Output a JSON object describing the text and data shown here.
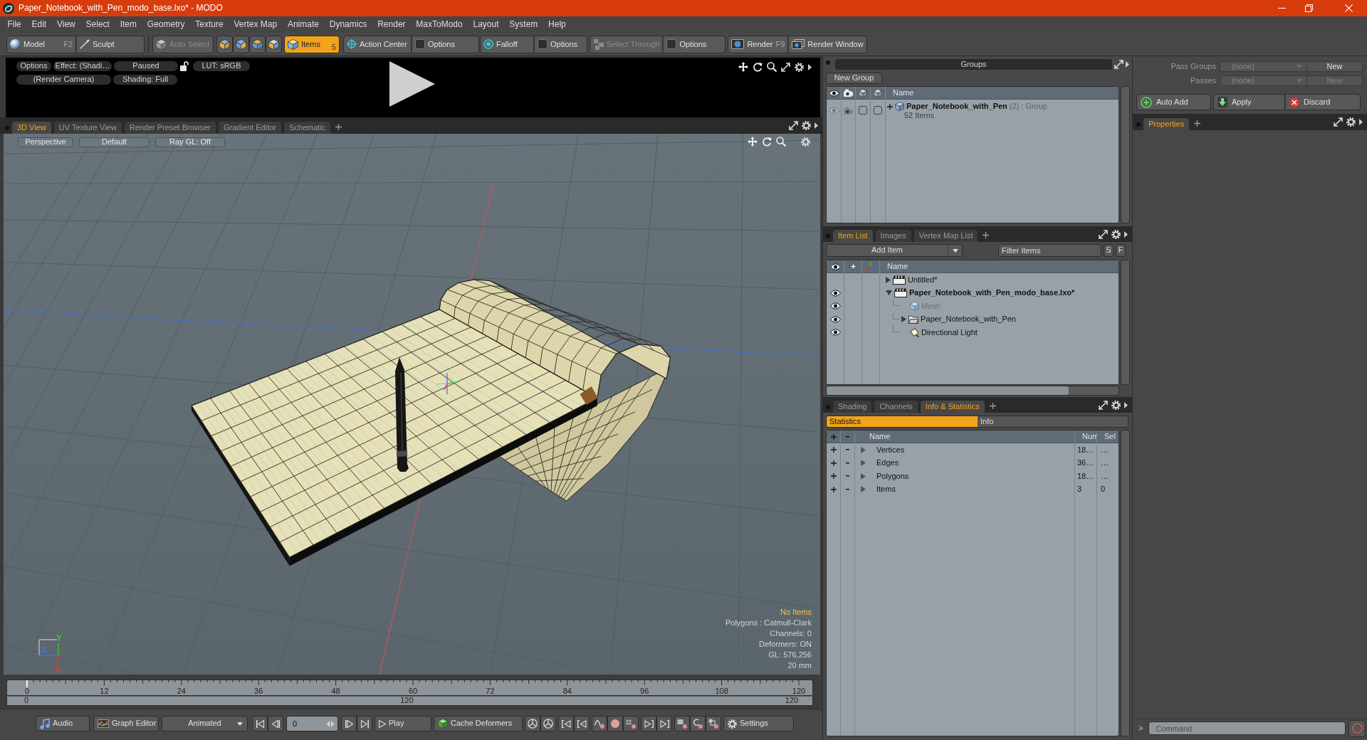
{
  "window": {
    "title": "Paper_Notebook_with_Pen_modo_base.lxo* - MODO"
  },
  "menu": [
    "File",
    "Edit",
    "View",
    "Select",
    "Item",
    "Geometry",
    "Texture",
    "Vertex Map",
    "Animate",
    "Dynamics",
    "Render",
    "MaxToModo",
    "Layout",
    "System",
    "Help"
  ],
  "toolbar": {
    "model": {
      "label": "Model",
      "shortcut": "F2"
    },
    "sculpt": {
      "label": "Sculpt"
    },
    "auto_select": {
      "label": "Auto Select",
      "disabled": true
    },
    "selection_modes": [
      {
        "kind": "icon",
        "selected": false
      },
      {
        "kind": "icon",
        "selected": false
      },
      {
        "kind": "icon",
        "selected": false
      },
      {
        "kind": "icon",
        "selected": false
      },
      {
        "kind": "labeled",
        "label": "Items",
        "shortcut": "5",
        "selected": true
      }
    ],
    "action_center": {
      "label": "Action Center",
      "options": {
        "label": "Options",
        "checked": false
      }
    },
    "falloff": {
      "label": "Falloff",
      "options": {
        "label": "Options",
        "checked": false
      }
    },
    "select_through": {
      "label": "Select Through",
      "disabled": true,
      "options": {
        "label": "Options",
        "checked": false
      }
    },
    "render": {
      "label": "Render",
      "shortcut": "F9"
    },
    "render_window": {
      "label": "Render Window"
    }
  },
  "preview": {
    "options": "Options",
    "effect": "Effect: (Shadi…",
    "state": "Paused",
    "lut": "LUT: sRGB",
    "camera": "(Render Camera)",
    "shading": "Shading: Full"
  },
  "viewport_tabs": [
    {
      "label": "3D View",
      "selected": true
    },
    {
      "label": "UV Texture View",
      "selected": false
    },
    {
      "label": "Render Preset Browser",
      "selected": false
    },
    {
      "label": "Gradient Editor",
      "selected": false
    },
    {
      "label": "Schematic",
      "selected": false
    }
  ],
  "viewport": {
    "view_buttons": [
      "Perspective",
      "Default",
      "Ray GL: Off"
    ],
    "selection_info": "No Items",
    "info_lines": [
      "Polygons : Catmull-Clark",
      "Channels: 0",
      "Deformers: ON",
      "GL: 576,256",
      "20 mm"
    ],
    "axis_labels": [
      {
        "label": "Y",
        "color": "#3ec43e"
      },
      {
        "label": "Z",
        "color": "#4a6cf0"
      },
      {
        "label": "X",
        "color": "#e03c3c"
      }
    ]
  },
  "timeline": {
    "ticks": [
      "0",
      "12",
      "24",
      "36",
      "48",
      "60",
      "72",
      "84",
      "96",
      "108",
      "120"
    ],
    "range": [
      "0",
      "120",
      "120"
    ],
    "level": 0
  },
  "transport": {
    "audio": "Audio",
    "graph_editor": "Graph Editor",
    "mode": "Animated",
    "frame": "0",
    "play": "Play",
    "cache": "Cache Deformers",
    "settings": "Settings"
  },
  "groups": {
    "title": "Groups",
    "new_group": "New Group",
    "column": "Name",
    "rows": [
      {
        "name": "Paper_Notebook_with_Pen",
        "count": "(2)",
        "type": ": Group",
        "items": "52 Items",
        "expanded": false
      }
    ]
  },
  "item_list": {
    "tabs": [
      {
        "label": "Item List",
        "selected": true
      },
      {
        "label": "Images",
        "selected": false
      },
      {
        "label": "Vertex Map List",
        "selected": false
      }
    ],
    "add_item": "Add Item",
    "filter": {
      "placeholder": "Filter Items"
    },
    "filter_buttons": [
      "S",
      "F"
    ],
    "column": "Name",
    "items": [
      {
        "kind": "scene",
        "name": "Untitled*",
        "visible": false,
        "expanded": false,
        "current": false
      },
      {
        "kind": "scene",
        "name": "Paper_Notebook_with_Pen_modo_base.lxo*",
        "visible": true,
        "expanded": true,
        "current": true,
        "children": [
          {
            "kind": "mesh",
            "name": "Mesh",
            "visible": true,
            "disabled": true
          },
          {
            "kind": "group",
            "name": "Paper_Notebook_with_Pen",
            "visible": true,
            "disabled": false,
            "expanded": false
          },
          {
            "kind": "light",
            "name": "Directional Light",
            "visible": true,
            "disabled": false
          }
        ]
      }
    ]
  },
  "statistics": {
    "tabs": [
      {
        "label": "Shading",
        "selected": false
      },
      {
        "label": "Channels",
        "selected": false
      },
      {
        "label": "Info & Statistics",
        "selected": true
      }
    ],
    "views": [
      {
        "label": "Statistics",
        "selected": true
      },
      {
        "label": "Info",
        "selected": false
      }
    ],
    "columns": [
      "Name",
      "Num",
      "Sel"
    ],
    "rows": [
      {
        "name": "Vertices",
        "num": "18…",
        "sel": "…",
        "expanded": false
      },
      {
        "name": "Edges",
        "num": "36…",
        "sel": "…",
        "expanded": false
      },
      {
        "name": "Polygons",
        "num": "18…",
        "sel": "…",
        "expanded": false
      },
      {
        "name": "Items",
        "num": "3",
        "sel": "0",
        "expanded": false
      }
    ]
  },
  "passes": {
    "pass_groups": {
      "label": "Pass Groups",
      "value": "(none)",
      "button": "New",
      "disabled": false
    },
    "passes": {
      "label": "Passes",
      "value": "(none)",
      "button": "New",
      "disabled": true
    },
    "actions": [
      "Auto Add",
      "Apply",
      "Discard"
    ]
  },
  "properties_tabs": [
    {
      "label": "Properties",
      "selected": true
    }
  ],
  "command": {
    "prompt": ">",
    "placeholder": "Command"
  }
}
